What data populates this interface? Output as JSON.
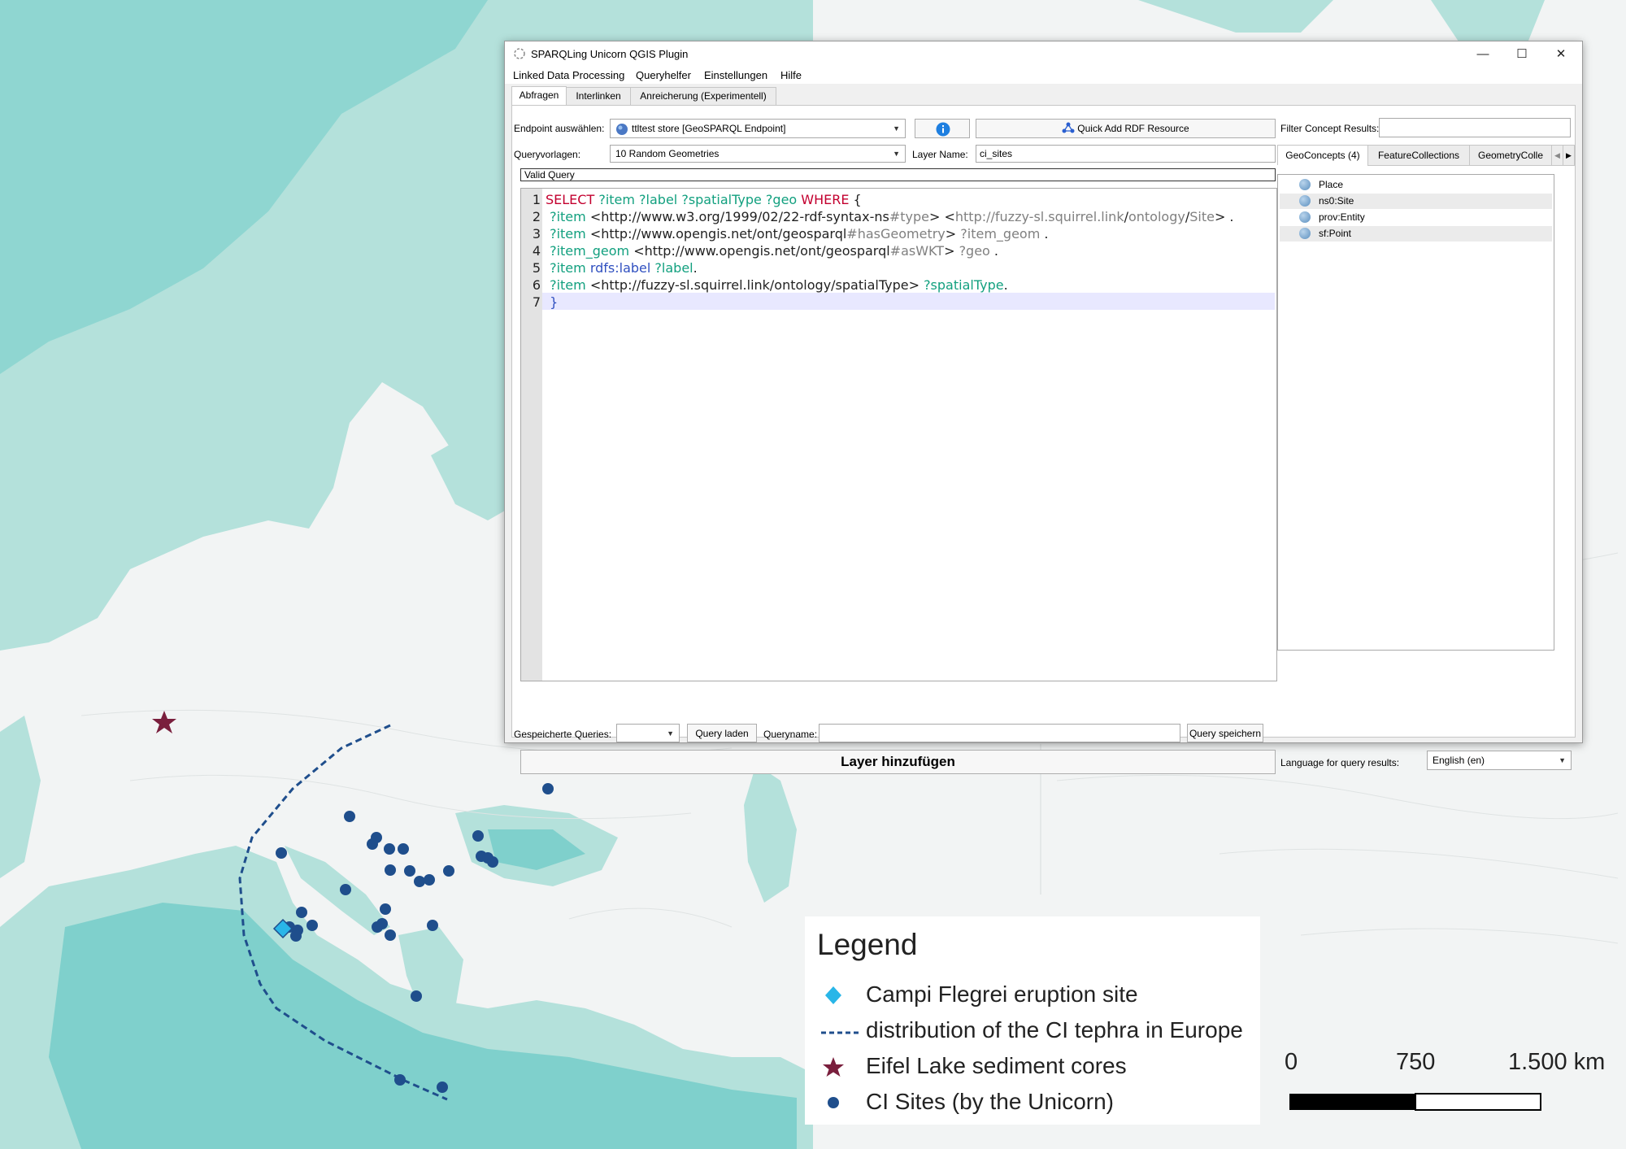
{
  "window": {
    "title": "SPARQLing Unicorn QGIS Plugin",
    "controls": [
      "—",
      "☐",
      "✕"
    ]
  },
  "menu": [
    "Linked Data Processing",
    "Queryhelfer",
    "Einstellungen",
    "Hilfe"
  ],
  "tabs": [
    "Abfragen",
    "Interlinken",
    "Anreicherung (Experimentell)"
  ],
  "endpoint": {
    "label": "Endpoint auswählen:",
    "value": "ttltest store [GeoSPARQL Endpoint]",
    "info_icon": "info-icon",
    "quick_add": "Quick Add RDF Resource"
  },
  "filter": {
    "label": "Filter Concept Results:",
    "value": ""
  },
  "queryvorlagen": {
    "label": "Queryvorlagen:",
    "value": "10 Random Geometries"
  },
  "layer_name": {
    "label": "Layer Name:",
    "value": "ci_sites"
  },
  "valid_query": "Valid Query",
  "code": {
    "line_numbers": [
      "1",
      "2",
      "3",
      "4",
      "5",
      "6",
      "7"
    ],
    "l1": {
      "kw1": "SELECT",
      "vars": " ?item ?label ?spatialType ?geo ",
      "kw2": "WHERE",
      "rest": " {"
    },
    "l2": {
      "v": " ?item",
      "a": " <http://www.w3.org/1999/02/22-rdf-syntax-ns",
      "b": "#type",
      "c": "> <",
      "d": "http://",
      "e": "fuzzy-sl.squirrel.link",
      "f": "/",
      "g": "ontology",
      "h": "/",
      "i": "Site",
      "j": "> ."
    },
    "l3": {
      "v": " ?item",
      "a": " <http://www.opengis.net/ont/geosparql",
      "b": "#hasGeometry",
      "c": "> ",
      "d": "?item_geom",
      "e": " ."
    },
    "l4": {
      "v": " ?item_geom",
      "a": " <http://www.opengis.net/ont/geosparql",
      "b": "#asWKT",
      "c": "> ",
      "d": "?geo",
      "e": " ."
    },
    "l5": {
      "v": " ?item",
      "a": " rdfs:label",
      "b": " ?label",
      "c": "."
    },
    "l6": {
      "v": " ?item",
      "a": " <http://fuzzy-sl.squirrel.link/ontology/spatialType> ",
      "b": "?spatialType",
      "c": "."
    },
    "l7": " }"
  },
  "concept_tabs": [
    "GeoConcepts (4)",
    "FeatureCollections",
    "GeometryColle"
  ],
  "concepts": [
    "Place",
    "ns0:Site",
    "prov:Entity",
    "sf:Point"
  ],
  "saved": {
    "label": "Gespeicherte Queries:",
    "load_button": "Query laden",
    "name_label": "Queryname:",
    "name_value": "",
    "save_button": "Query speichern"
  },
  "add_layer": "Layer hinzufügen",
  "language": {
    "label": "Language for query results:",
    "value": "English (en)"
  },
  "legend": {
    "title": "Legend",
    "items": [
      {
        "label": "Campi Flegrei eruption site",
        "symbol": "diamond",
        "color": "#29b6e8"
      },
      {
        "label": "distribution of the CI tephra in Europe",
        "symbol": "dashed-line",
        "color": "#1f4e8c"
      },
      {
        "label": "Eifel Lake sediment cores",
        "symbol": "star",
        "color": "#7a1f3d"
      },
      {
        "label": "CI Sites (by the Unicorn)",
        "symbol": "dot",
        "color": "#1f4e8c"
      }
    ]
  },
  "scalebar": {
    "labels": [
      "0",
      "750",
      "1.500 km"
    ]
  },
  "colors": {
    "sea": "#b4e1db",
    "deep_sea": "#7fd0cc",
    "land": "#f2f4f4",
    "site": "#1f4e8c"
  }
}
